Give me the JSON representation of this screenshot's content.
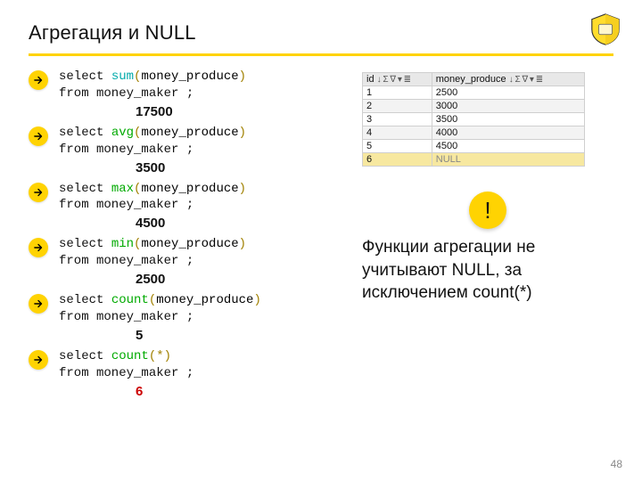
{
  "slide": {
    "title": "Агрегация и NULL",
    "page_number": "48"
  },
  "queries": [
    {
      "fn": "sum",
      "fn_color": "teal",
      "arg": "money_produce",
      "star": false,
      "from": "from money_maker ;",
      "result": "17500",
      "result_red": false
    },
    {
      "fn": "avg",
      "fn_color": "green",
      "arg": "money_produce",
      "star": false,
      "from": "from money_maker ;",
      "result": "3500",
      "result_red": false
    },
    {
      "fn": "max",
      "fn_color": "green",
      "arg": "money_produce",
      "star": false,
      "from": "from money_maker ;",
      "result": "4500",
      "result_red": false
    },
    {
      "fn": "min",
      "fn_color": "green",
      "arg": "money_produce",
      "star": false,
      "from": "from money_maker ;",
      "result": "2500",
      "result_red": false
    },
    {
      "fn": "count",
      "fn_color": "green",
      "arg": "money_produce",
      "star": false,
      "from": "from money_maker ;",
      "result": "5",
      "result_red": false
    },
    {
      "fn": "count",
      "fn_color": "green",
      "arg": "*",
      "star": true,
      "from": "from money_maker ;",
      "result": "6",
      "result_red": true
    }
  ],
  "table": {
    "headers": [
      "id",
      "money_produce"
    ],
    "rows": [
      {
        "id": "1",
        "val": "2500",
        "even": false,
        "sel": false,
        "null": false
      },
      {
        "id": "2",
        "val": "3000",
        "even": true,
        "sel": false,
        "null": false
      },
      {
        "id": "3",
        "val": "3500",
        "even": false,
        "sel": false,
        "null": false
      },
      {
        "id": "4",
        "val": "4000",
        "even": true,
        "sel": false,
        "null": false
      },
      {
        "id": "5",
        "val": "4500",
        "even": false,
        "sel": false,
        "null": false
      },
      {
        "id": "6",
        "val": "NULL",
        "even": true,
        "sel": true,
        "null": true
      }
    ]
  },
  "callout": {
    "icon_glyph": "!",
    "text": "Функции агрегации не учитывают NULL, за исключением count(*)"
  },
  "tokens": {
    "select": "select ",
    "tool_glyphs": "↓ Σ ∇ ▾ ≣"
  }
}
